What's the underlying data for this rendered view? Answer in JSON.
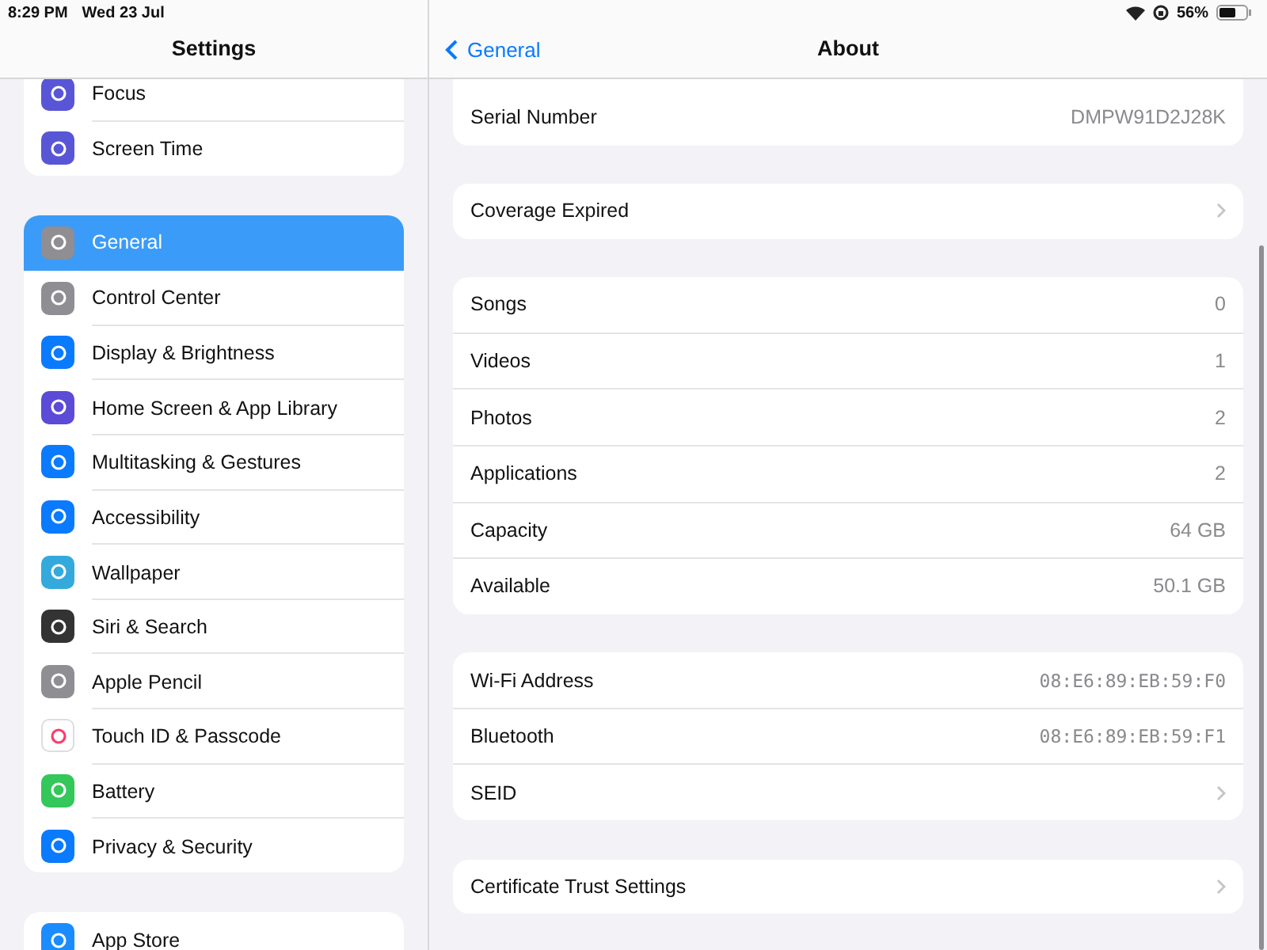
{
  "status_bar": {
    "time": "8:29 PM",
    "date": "Wed 23 Jul",
    "battery": "56%"
  },
  "sidebar": {
    "title": "Settings",
    "groups": [
      {
        "items": [
          {
            "label": "Focus",
            "selected": false
          },
          {
            "label": "Screen Time",
            "selected": false
          }
        ]
      },
      {
        "items": [
          {
            "label": "General",
            "selected": true
          },
          {
            "label": "Control Center",
            "selected": false
          },
          {
            "label": "Display & Brightness",
            "selected": false
          },
          {
            "label": "Home Screen & App Library",
            "selected": false
          },
          {
            "label": "Multitasking & Gestures",
            "selected": false
          },
          {
            "label": "Accessibility",
            "selected": false
          },
          {
            "label": "Wallpaper",
            "selected": false
          },
          {
            "label": "Siri & Search",
            "selected": false
          },
          {
            "label": "Apple Pencil",
            "selected": false
          },
          {
            "label": "Touch ID & Passcode",
            "selected": false
          },
          {
            "label": "Battery",
            "selected": false
          },
          {
            "label": "Privacy & Security",
            "selected": false
          }
        ]
      },
      {
        "items": [
          {
            "label": "App Store",
            "selected": false
          }
        ]
      }
    ]
  },
  "detail": {
    "back": "General",
    "title": "About",
    "groups": [
      {
        "rows": [
          {
            "kind": "value",
            "label": "Serial Number",
            "value": "DMPW91D2J28K"
          }
        ]
      },
      {
        "rows": [
          {
            "kind": "link",
            "label": "Coverage Expired"
          }
        ]
      },
      {
        "rows": [
          {
            "kind": "value",
            "label": "Songs",
            "value": "0"
          },
          {
            "kind": "value",
            "label": "Videos",
            "value": "1"
          },
          {
            "kind": "value",
            "label": "Photos",
            "value": "2"
          },
          {
            "kind": "value",
            "label": "Applications",
            "value": "2"
          },
          {
            "kind": "value",
            "label": "Capacity",
            "value": "64 GB"
          },
          {
            "kind": "value",
            "label": "Available",
            "value": "50.1 GB"
          }
        ]
      },
      {
        "rows": [
          {
            "kind": "address",
            "label": "Wi-Fi Address",
            "value": "08:E6:89:EB:59:F0"
          },
          {
            "kind": "address",
            "label": "Bluetooth",
            "value": "08:E6:89:EB:59:F1"
          },
          {
            "kind": "link",
            "label": "SEID"
          }
        ]
      },
      {
        "rows": [
          {
            "kind": "link",
            "label": "Certificate Trust Settings"
          }
        ]
      }
    ]
  }
}
